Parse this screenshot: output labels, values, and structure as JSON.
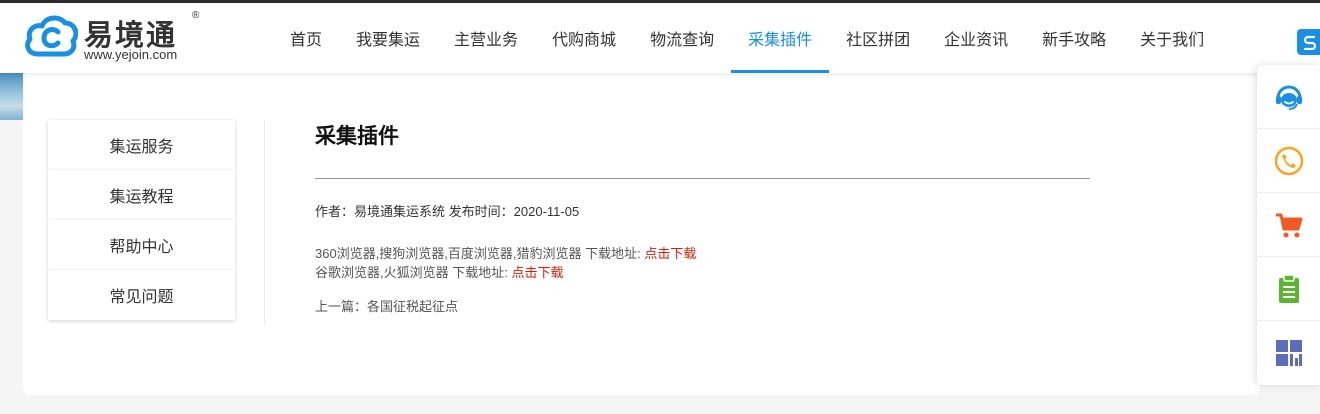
{
  "brand": {
    "name": "易境通",
    "reg": "®",
    "url": "www.yejoin.com",
    "color": "#1a8fe3"
  },
  "nav": [
    {
      "label": "首页"
    },
    {
      "label": "我要集运"
    },
    {
      "label": "主营业务"
    },
    {
      "label": "代购商城"
    },
    {
      "label": "物流查询"
    },
    {
      "label": "采集插件",
      "active": true
    },
    {
      "label": "社区拼团"
    },
    {
      "label": "企业资讯"
    },
    {
      "label": "新手攻略"
    },
    {
      "label": "关于我们"
    }
  ],
  "sidebar": {
    "items": [
      {
        "label": "集运服务"
      },
      {
        "label": "集运教程"
      },
      {
        "label": "帮助中心"
      },
      {
        "label": "常见问题"
      }
    ]
  },
  "article": {
    "title": "采集插件",
    "author_label": "作者：",
    "author": "易境通集运系统",
    "date_label": "发布时间：",
    "date": "2020-11-05",
    "line1_text": "360浏览器,搜狗浏览器,百度浏览器,猎豹浏览器 下载地址: ",
    "line1_link": "点击下载",
    "line2_text": "谷歌浏览器,火狐浏览器 下载地址: ",
    "line2_link": "点击下载",
    "prev_label": "上一篇：",
    "prev_title": "各国征税起征点"
  },
  "rightbar": {
    "icons": [
      "customer-service-icon",
      "phone-icon",
      "cart-icon",
      "clipboard-icon",
      "qrcode-icon"
    ]
  }
}
